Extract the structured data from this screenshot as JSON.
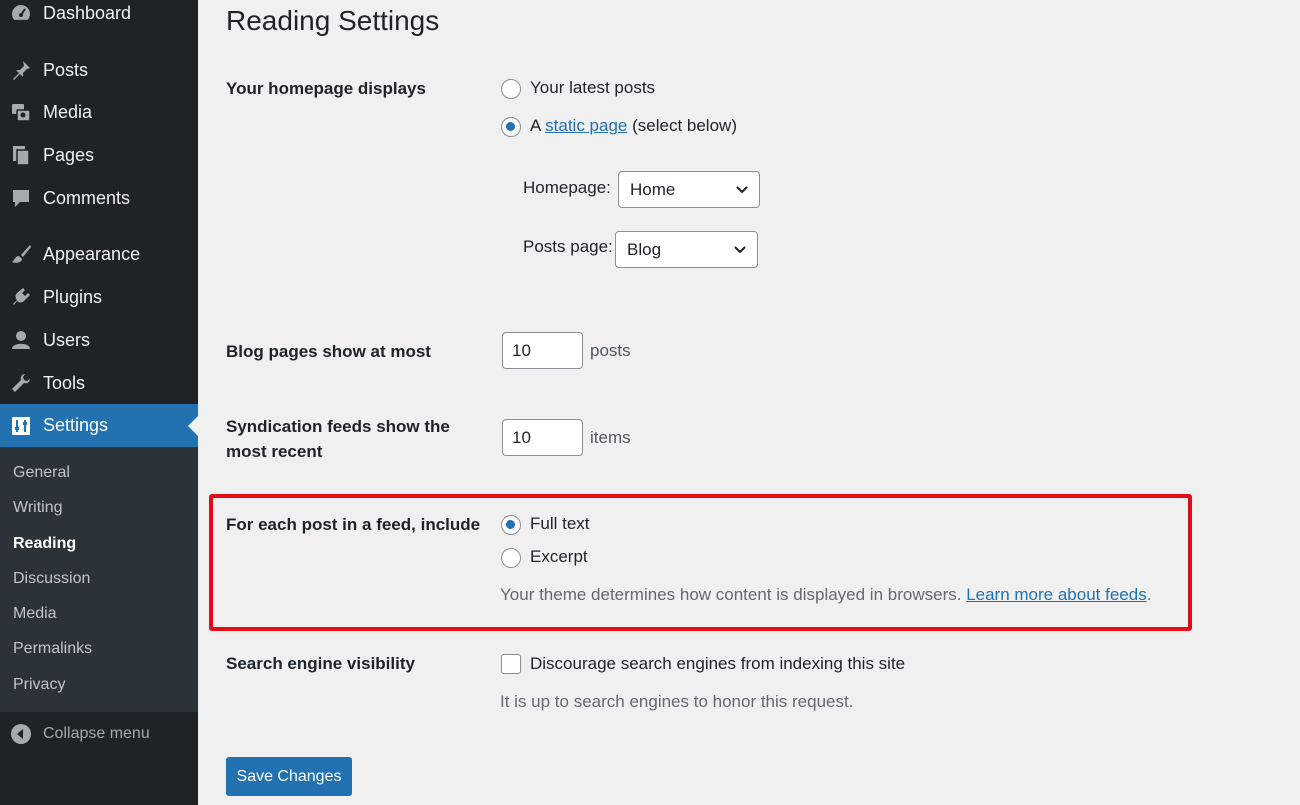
{
  "sidebar": {
    "items": [
      {
        "id": "dashboard",
        "label": "Dashboard",
        "icon": "dashboard-icon"
      },
      {
        "id": "posts",
        "label": "Posts",
        "icon": "pin-icon"
      },
      {
        "id": "media",
        "label": "Media",
        "icon": "media-icon"
      },
      {
        "id": "pages",
        "label": "Pages",
        "icon": "pages-icon"
      },
      {
        "id": "comments",
        "label": "Comments",
        "icon": "comment-icon"
      },
      {
        "id": "appearance",
        "label": "Appearance",
        "icon": "brush-icon"
      },
      {
        "id": "plugins",
        "label": "Plugins",
        "icon": "plugin-icon"
      },
      {
        "id": "users",
        "label": "Users",
        "icon": "user-icon"
      },
      {
        "id": "tools",
        "label": "Tools",
        "icon": "wrench-icon"
      },
      {
        "id": "settings",
        "label": "Settings",
        "icon": "settings-icon",
        "active": true
      }
    ],
    "submenu": [
      {
        "label": "General"
      },
      {
        "label": "Writing"
      },
      {
        "label": "Reading",
        "current": true
      },
      {
        "label": "Discussion"
      },
      {
        "label": "Media"
      },
      {
        "label": "Permalinks"
      },
      {
        "label": "Privacy"
      }
    ],
    "collapse_label": "Collapse menu"
  },
  "page": {
    "title": "Reading Settings"
  },
  "homepage": {
    "label": "Your homepage displays",
    "option_latest": "Your latest posts",
    "option_static_prefix": "A",
    "option_static_link": "static page",
    "option_static_suffix": "(select below)",
    "selected": "static",
    "homepage_label": "Homepage:",
    "homepage_value": "Home",
    "posts_page_label": "Posts page:",
    "posts_page_value": "Blog"
  },
  "blog_pages": {
    "label": "Blog pages show at most",
    "value": "10",
    "unit": "posts"
  },
  "syndication": {
    "label_line1": "Syndication feeds show the",
    "label_line2": "most recent",
    "value": "10",
    "unit": "items"
  },
  "feed_include": {
    "label": "For each post in a feed, include",
    "option_full": "Full text",
    "option_excerpt": "Excerpt",
    "selected": "full",
    "description": "Your theme determines how content is displayed in browsers.",
    "learn_more": "Learn more about feeds",
    "learn_more_suffix": "."
  },
  "search_visibility": {
    "label": "Search engine visibility",
    "checkbox_label": "Discourage search engines from indexing this site",
    "checked": false,
    "note": "It is up to search engines to honor this request."
  },
  "save_label": "Save Changes",
  "colors": {
    "sidebar_bg": "#1d2327",
    "submenu_bg": "#2c3338",
    "accent": "#2271b1",
    "highlight": "#e30b17",
    "page_bg": "#f0f0f1"
  }
}
